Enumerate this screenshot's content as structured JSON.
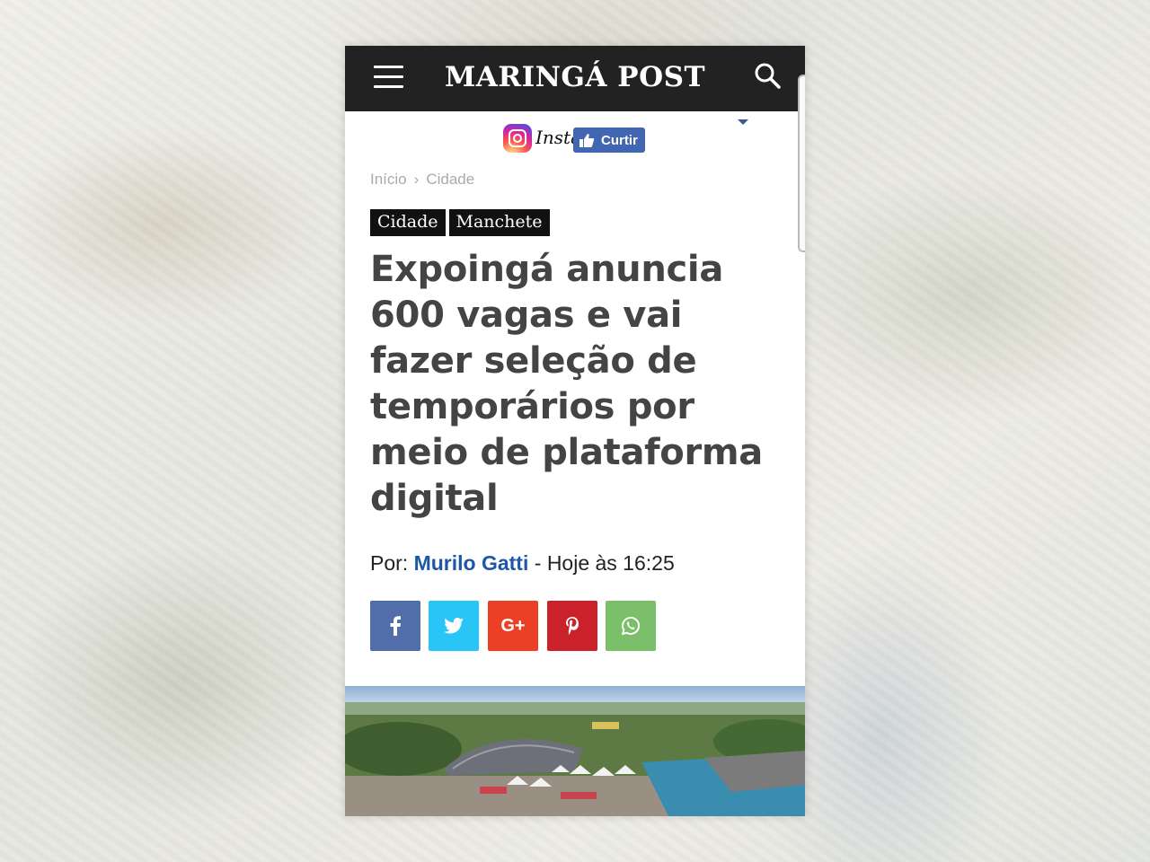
{
  "site": {
    "logo": "MARINGÁ POST"
  },
  "social": {
    "instagram_label": "Insta",
    "like_label": "Curtir"
  },
  "breadcrumb": {
    "home": "Início",
    "separator": "›",
    "current": "Cidade"
  },
  "tags": [
    "Cidade",
    "Manchete"
  ],
  "article": {
    "title": "Expoingá anuncia 600 vagas e vai fazer seleção de temporários por meio de plataforma digital",
    "by_prefix": "Por:",
    "author": "Murilo Gatti",
    "date_sep": " - ",
    "date": "Hoje às 16:25"
  },
  "share_buttons": [
    {
      "name": "facebook",
      "icon": "facebook-icon",
      "color": "#516eab"
    },
    {
      "name": "twitter",
      "icon": "twitter-icon",
      "color": "#29c5f6"
    },
    {
      "name": "googleplus",
      "icon": "google-plus-icon",
      "color": "#eb4026"
    },
    {
      "name": "pinterest",
      "icon": "pinterest-icon",
      "color": "#ca212a"
    },
    {
      "name": "whatsapp",
      "icon": "whatsapp-icon",
      "color": "#7bbf6a"
    }
  ],
  "colors": {
    "topbar": "#222222",
    "author": "#1e57a8",
    "title": "#444444"
  }
}
